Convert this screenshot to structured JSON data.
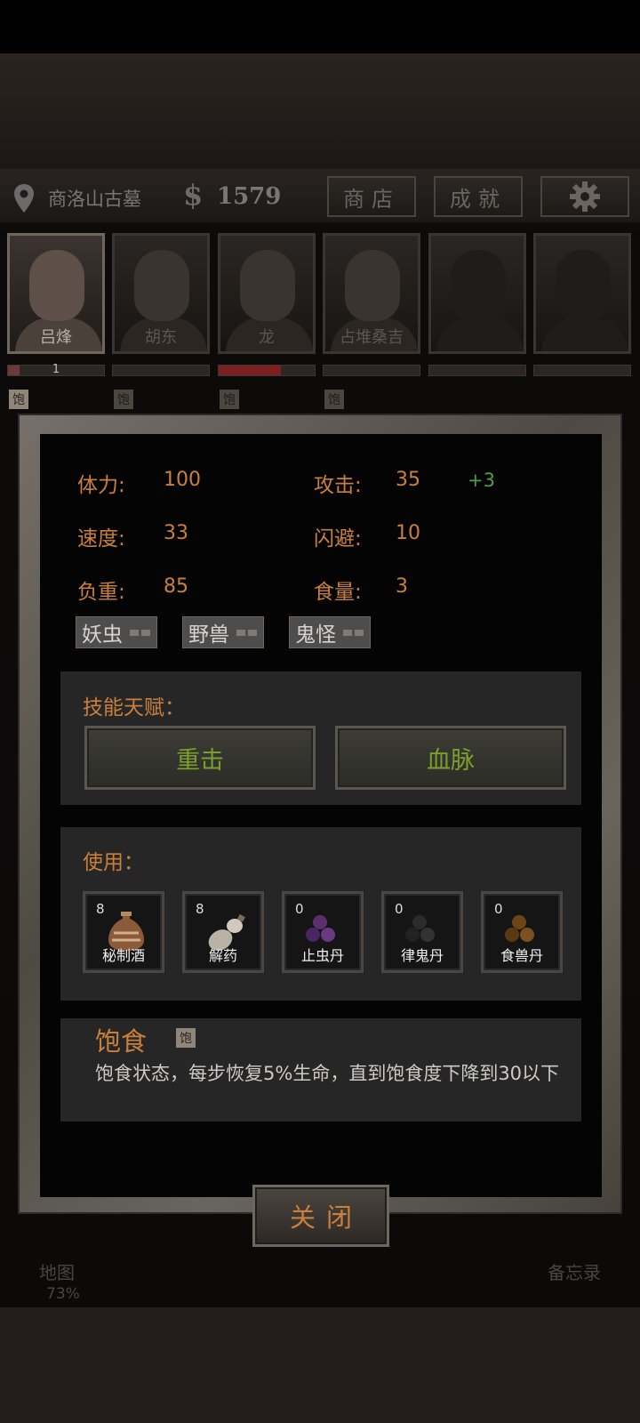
{
  "location": {
    "name": "商洛山古墓"
  },
  "money": {
    "symbol": "$",
    "amount": "1579"
  },
  "top_buttons": {
    "shop": "商店",
    "achievements": "成就"
  },
  "party": [
    {
      "name": "吕烽",
      "level": "1",
      "hp_fraction": 0.12,
      "satiated": "饱"
    },
    {
      "name": "胡东",
      "level": "",
      "hp_fraction": 0,
      "satiated": "饱"
    },
    {
      "name": "龙",
      "level": "",
      "hp_fraction": 0.65,
      "satiated": "饱"
    },
    {
      "name": "占堆桑吉",
      "level": "",
      "hp_fraction": 0,
      "satiated": "饱"
    },
    {
      "name": "",
      "level": "",
      "hp_fraction": 0,
      "satiated": ""
    },
    {
      "name": "",
      "level": "",
      "hp_fraction": 0,
      "satiated": ""
    }
  ],
  "stats": {
    "stamina_label": "体力:",
    "stamina": "100",
    "attack_label": "攻击:",
    "attack": "35",
    "attack_bonus": "+3",
    "speed_label": "速度:",
    "speed": "33",
    "dodge_label": "闪避:",
    "dodge": "10",
    "load_label": "负重:",
    "load": "85",
    "food_label": "食量:",
    "food": "3"
  },
  "resistances": [
    {
      "label": "妖虫"
    },
    {
      "label": "野兽"
    },
    {
      "label": "鬼怪"
    }
  ],
  "skills": {
    "title": "技能天赋：",
    "items": [
      "重击",
      "血脉"
    ]
  },
  "use": {
    "title": "使用：",
    "items": [
      {
        "name": "秘制酒",
        "count": "8",
        "icon": "wine-jar-icon"
      },
      {
        "name": "解药",
        "count": "8",
        "icon": "antidote-gourd-icon"
      },
      {
        "name": "止虫丹",
        "count": "0",
        "icon": "purple-pills-icon"
      },
      {
        "name": "律鬼丹",
        "count": "0",
        "icon": "black-pills-icon"
      },
      {
        "name": "食兽丹",
        "count": "0",
        "icon": "brown-pills-icon"
      }
    ]
  },
  "effect": {
    "name": "饱食",
    "badge": "饱",
    "description": "饱食状态，每步恢复5%生命，直到饱食度下降到30以下"
  },
  "close_label": "关闭",
  "bottom_nav": {
    "map": "地图",
    "map_percent": "73%",
    "memo": "备忘录"
  },
  "colors": {
    "accent": "#c9803c",
    "skill_text": "#7b9f2e",
    "bonus": "#4f9f46"
  }
}
